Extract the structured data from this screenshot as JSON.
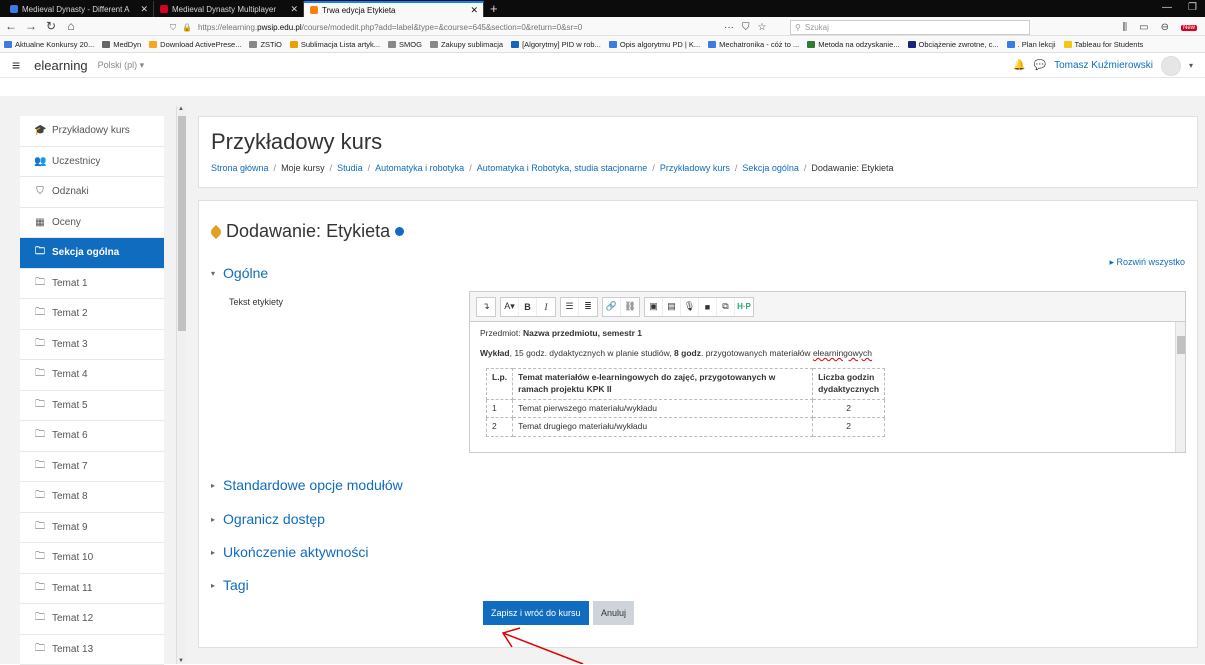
{
  "browser": {
    "tabs": [
      {
        "label": "Medieval Dynasty - Different A",
        "color": "#3b7be4"
      },
      {
        "label": "Medieval Dynasty Multiplayer",
        "color": "#d70022"
      },
      {
        "label": "Trwa edycja Etykieta",
        "color": "#f98012"
      }
    ],
    "url_prefix": "https://elearning.",
    "url_domain": "pwsip.edu.pl",
    "url_suffix": "/course/modedit.php?add=label&type=&course=645&section=0&return=0&sr=0",
    "search_placeholder": "Szukaj",
    "new_badge": "New",
    "bookmarks": [
      "Aktualne Konkursy 20...",
      "MedDyn",
      "Download ActivePrese...",
      "ZSTiO",
      "Sublimacja Lista artyk...",
      "SMOG",
      "Zakupy sublimacja",
      "[Algorytmy] PID w rob...",
      "Opis algorytmu PD | K...",
      "Mechatronika - cóż to ...",
      "Metoda na odzyskanie...",
      "Obciążenie zwrotne, c...",
      ". Plan lekcji",
      "Tableau for Students"
    ]
  },
  "header": {
    "brand": "elearning",
    "lang": "Polski (pl) ▾",
    "user": "Tomasz Kuźmierowski"
  },
  "sidebar": {
    "items": [
      {
        "label": "Przykładowy kurs",
        "icon": "graduation-cap-icon",
        "glyph": "🎓"
      },
      {
        "label": "Uczestnicy",
        "icon": "users-icon",
        "glyph": "👥"
      },
      {
        "label": "Odznaki",
        "icon": "shield-icon",
        "glyph": "⛉"
      },
      {
        "label": "Oceny",
        "icon": "table-icon",
        "glyph": "▦"
      },
      {
        "label": "Sekcja ogólna",
        "icon": "folder-icon",
        "glyph": "🗀"
      },
      {
        "label": "Temat 1",
        "icon": "folder-icon",
        "glyph": "🗀"
      },
      {
        "label": "Temat 2",
        "icon": "folder-icon",
        "glyph": "🗀"
      },
      {
        "label": "Temat 3",
        "icon": "folder-icon",
        "glyph": "🗀"
      },
      {
        "label": "Temat 4",
        "icon": "folder-icon",
        "glyph": "🗀"
      },
      {
        "label": "Temat 5",
        "icon": "folder-icon",
        "glyph": "🗀"
      },
      {
        "label": "Temat 6",
        "icon": "folder-icon",
        "glyph": "🗀"
      },
      {
        "label": "Temat 7",
        "icon": "folder-icon",
        "glyph": "🗀"
      },
      {
        "label": "Temat 8",
        "icon": "folder-icon",
        "glyph": "🗀"
      },
      {
        "label": "Temat 9",
        "icon": "folder-icon",
        "glyph": "🗀"
      },
      {
        "label": "Temat 10",
        "icon": "folder-icon",
        "glyph": "🗀"
      },
      {
        "label": "Temat 11",
        "icon": "folder-icon",
        "glyph": "🗀"
      },
      {
        "label": "Temat 12",
        "icon": "folder-icon",
        "glyph": "🗀"
      },
      {
        "label": "Temat 13",
        "icon": "folder-icon",
        "glyph": "🗀"
      }
    ],
    "active_index": 4
  },
  "course": {
    "title": "Przykładowy kurs",
    "breadcrumb": [
      "Strona główna",
      "Moje kursy",
      "Studia",
      "Automatyka i robotyka",
      "Automatyka i Robotyka, studia stacjonarne",
      "Przykładowy kurs",
      "Sekcja ogólna",
      "Dodawanie: Etykieta"
    ]
  },
  "form": {
    "title": "Dodawanie: Etykieta",
    "expand_all": "Rozwiń wszystko",
    "general": "Ogólne",
    "field_label": "Tekst etykiety",
    "sections": [
      "Standardowe opcje modułów",
      "Ogranicz dostęp",
      "Ukończenie aktywności",
      "Tagi"
    ],
    "save_label": "Zapisz i wróć do kursu",
    "cancel_label": "Anuluj"
  },
  "editor": {
    "subject_prefix": "Przedmiot: ",
    "subject_value": "Nazwa przedmiotu, semestr 1",
    "lecture_bold": "Wykład",
    "lecture_mid": ", 15 godz. dydaktycznych w planie studiów, ",
    "lecture_bold2": "8 godz",
    "lecture_end": ". przygotowanych materiałów ",
    "lecture_word": "elearningowych",
    "table_headers": [
      "L.p.",
      "Temat materiałów e-learningowych do zajęć, przygotowanych w ramach projektu KPK II",
      "Liczba godzin dydaktycznych"
    ],
    "rows": [
      [
        "1",
        "Temat pierwszego materiału/wykładu",
        "2"
      ],
      [
        "2",
        "Temat drugiego materiału/wykładu",
        "2"
      ]
    ]
  },
  "colors": {
    "accent": "#0f6cbf",
    "annotation_arrow": "#e00000"
  }
}
